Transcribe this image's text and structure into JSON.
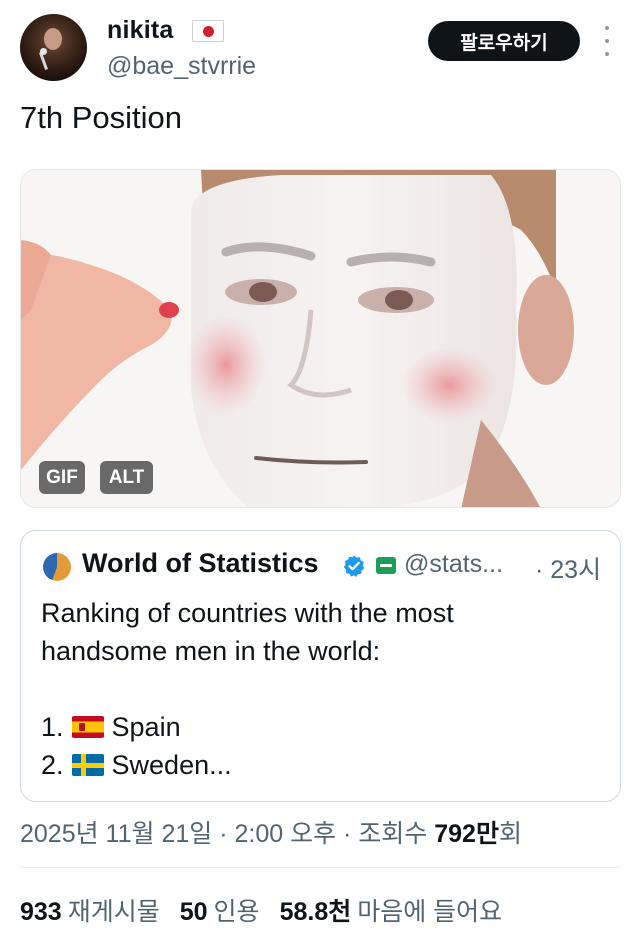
{
  "author": {
    "display_name": "nikita",
    "flag_icon": "japan-flag-icon",
    "handle": "@bae_stvrrie",
    "follow_label": "팔로우하기"
  },
  "tweet": {
    "text": "7th Position",
    "media_badges": {
      "gif": "GIF",
      "alt": "ALT"
    }
  },
  "quote": {
    "name": "World of Statistics",
    "handle": "@stats...",
    "time": "· 23시",
    "lines": [
      "Ranking of countries with the most",
      "handsome men in the world:",
      "",
      "1.",
      "Spain",
      "2.",
      "Sweden..."
    ]
  },
  "meta": {
    "timestamp": "2025년 11월 21일 · 2:00 오후 · 조회수 ",
    "views_number": "792",
    "views_unit": "만",
    "views_suffix": "회"
  },
  "stats": {
    "reposts_count": "933",
    "reposts_label": "재게시물",
    "quotes_count": "50",
    "quotes_label": "인용",
    "likes_count": "58.8천",
    "likes_label": "마음에 들어요"
  },
  "colors": {
    "accent_verified": "#1d9bf0",
    "text_primary": "#0f1419",
    "text_secondary": "#536471",
    "follow_button": "#0f1419"
  }
}
